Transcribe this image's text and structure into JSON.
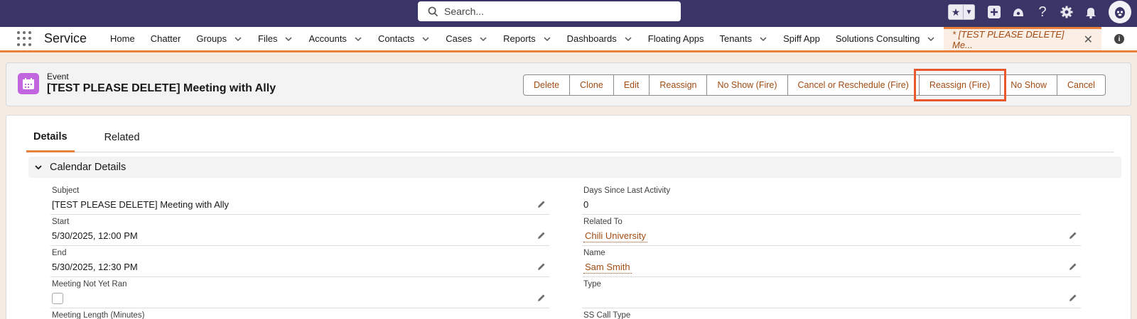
{
  "header": {
    "search_placeholder": "Search...",
    "icons": [
      "star-icon",
      "chevron-down-icon",
      "add-icon",
      "trailhead-icon",
      "help-icon",
      "setup-gear-icon",
      "notification-bell-icon",
      "user-avatar"
    ]
  },
  "nav": {
    "app_name": "Service",
    "items": [
      {
        "label": "Home",
        "has_menu": false
      },
      {
        "label": "Chatter",
        "has_menu": false
      },
      {
        "label": "Groups",
        "has_menu": true
      },
      {
        "label": "Files",
        "has_menu": true
      },
      {
        "label": "Accounts",
        "has_menu": true
      },
      {
        "label": "Contacts",
        "has_menu": true
      },
      {
        "label": "Cases",
        "has_menu": true
      },
      {
        "label": "Reports",
        "has_menu": true
      },
      {
        "label": "Dashboards",
        "has_menu": true
      },
      {
        "label": "Floating Apps",
        "has_menu": false
      },
      {
        "label": "Tenants",
        "has_menu": true
      },
      {
        "label": "Spiff App",
        "has_menu": false
      },
      {
        "label": "Solutions Consulting",
        "has_menu": true
      }
    ],
    "active_tab": "* [TEST PLEASE DELETE] Me...",
    "close_glyph": "✕",
    "info_glyph": "i"
  },
  "record": {
    "type": "Event",
    "title": "[TEST PLEASE DELETE] Meeting with Ally",
    "icon_color": "#c266e0"
  },
  "actions": {
    "buttons": [
      "Delete",
      "Clone",
      "Edit",
      "Reassign",
      "No Show (Fire)",
      "Cancel or Reschedule (Fire)",
      "Reassign (Fire)",
      "No Show",
      "Cancel"
    ],
    "highlighted": "Reassign (Fire)"
  },
  "tabs": {
    "details": "Details",
    "related": "Related",
    "active": "Details"
  },
  "section": {
    "title": "Calendar Details"
  },
  "fields": {
    "subject": {
      "label": "Subject",
      "value": "[TEST PLEASE DELETE] Meeting with Ally"
    },
    "start": {
      "label": "Start",
      "value": "5/30/2025, 12:00 PM"
    },
    "end": {
      "label": "End",
      "value": "5/30/2025, 12:30 PM"
    },
    "meeting_not_yet_ran": {
      "label": "Meeting Not Yet Ran",
      "checked": false
    },
    "days_since_last_activity": {
      "label": "Days Since Last Activity",
      "value": "0"
    },
    "related_to": {
      "label": "Related To",
      "value": "Chili University"
    },
    "name": {
      "label": "Name",
      "value": "Sam Smith"
    },
    "type": {
      "label": "Type",
      "value": ""
    },
    "partial_left": "Meeting Length (Minutes)",
    "partial_right": "SS Call Type"
  },
  "colors": {
    "header_bg": "#3a3567",
    "accent_orange": "#e9803b",
    "link_brown": "#a14b12",
    "highlight_red": "#e8582c"
  }
}
